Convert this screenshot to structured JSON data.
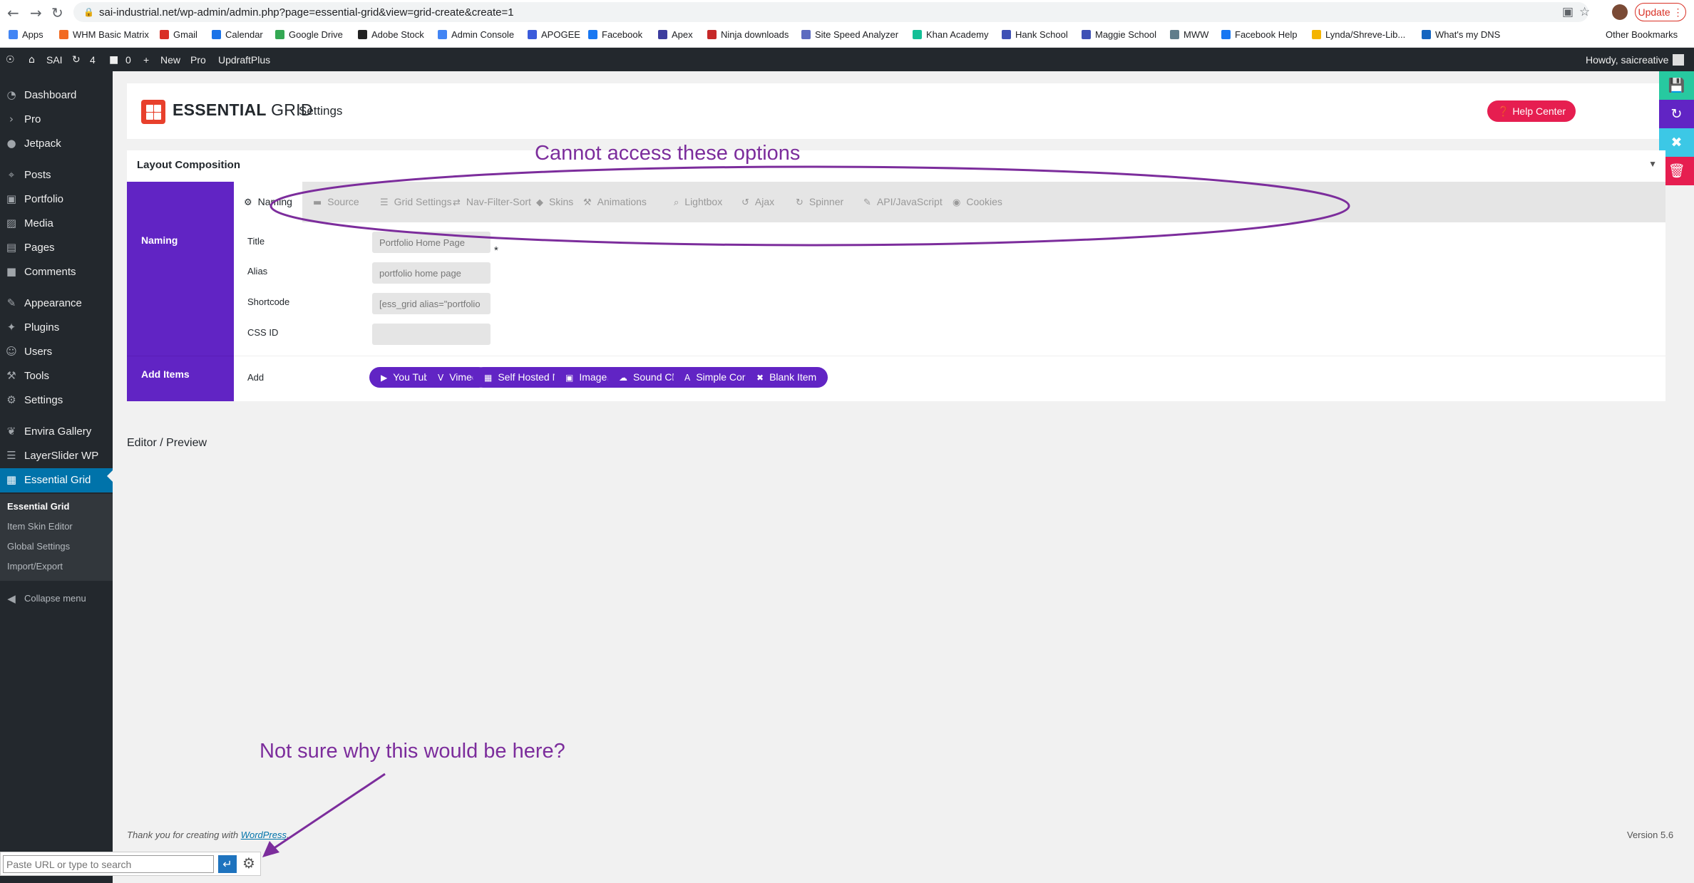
{
  "browser": {
    "url": "sai-industrial.net/wp-admin/admin.php?page=essential-grid&view=grid-create&create=1",
    "update_label": "Update",
    "bookmarks": [
      {
        "label": "Apps",
        "color": "#4285f4"
      },
      {
        "label": "WHM Basic Matrix",
        "color": "#f26a21"
      },
      {
        "label": "Gmail",
        "color": "#d93025"
      },
      {
        "label": "Calendar",
        "color": "#1a73e8"
      },
      {
        "label": "Google Drive",
        "color": "#34a853"
      },
      {
        "label": "Adobe Stock",
        "color": "#222222"
      },
      {
        "label": "Admin Console",
        "color": "#4285f4"
      },
      {
        "label": "APOGEE",
        "color": "#3b5bdb"
      },
      {
        "label": "Facebook",
        "color": "#1877f2"
      },
      {
        "label": "Apex",
        "color": "#3d3d9e"
      },
      {
        "label": "Ninja downloads",
        "color": "#c62828"
      },
      {
        "label": "Site Speed Analyzer",
        "color": "#5c6bc0"
      },
      {
        "label": "Khan Academy",
        "color": "#14bf96"
      },
      {
        "label": "Hank School",
        "color": "#3f51b5"
      },
      {
        "label": "Maggie School",
        "color": "#3f51b5"
      },
      {
        "label": "MWW",
        "color": "#607d8b"
      },
      {
        "label": "Facebook Help",
        "color": "#1877f2"
      },
      {
        "label": "Lynda/Shreve-Lib...",
        "color": "#f4b400"
      },
      {
        "label": "What's my DNS",
        "color": "#1565c0"
      }
    ],
    "other_bookmarks": "Other Bookmarks"
  },
  "adminbar": {
    "site": "SAI",
    "updates": "4",
    "comments": "0",
    "new": "New",
    "pro": "Pro",
    "updraft": "UpdraftPlus",
    "howdy": "Howdy, saicreative"
  },
  "sidebar": {
    "items": [
      {
        "label": "Dashboard",
        "icon": "dashboard-icon"
      },
      {
        "label": "Pro",
        "icon": "chevron-right-icon"
      },
      {
        "label": "Jetpack",
        "icon": "jetpack-icon"
      },
      {
        "label": "Posts",
        "icon": "pin-icon"
      },
      {
        "label": "Portfolio",
        "icon": "portfolio-icon"
      },
      {
        "label": "Media",
        "icon": "media-icon"
      },
      {
        "label": "Pages",
        "icon": "pages-icon"
      },
      {
        "label": "Comments",
        "icon": "comment-icon"
      },
      {
        "label": "Appearance",
        "icon": "brush-icon"
      },
      {
        "label": "Plugins",
        "icon": "plugin-icon"
      },
      {
        "label": "Users",
        "icon": "users-icon"
      },
      {
        "label": "Tools",
        "icon": "wrench-icon"
      },
      {
        "label": "Settings",
        "icon": "settings-icon"
      },
      {
        "label": "Envira Gallery",
        "icon": "leaf-icon"
      },
      {
        "label": "LayerSlider WP",
        "icon": "layers-icon"
      },
      {
        "label": "Essential Grid",
        "icon": "grid-icon"
      }
    ],
    "submenu": [
      "Essential Grid",
      "Item Skin Editor",
      "Global Settings",
      "Import/Export"
    ],
    "collapse": "Collapse menu"
  },
  "header": {
    "brand_bold": "ESSENTIAL",
    "brand_light": "GRID",
    "settings": "Settings",
    "help": "Help Center"
  },
  "layout": {
    "title": "Layout Composition",
    "sections": {
      "naming": "Naming",
      "add_items": "Add Items"
    },
    "tabs": [
      {
        "label": "Naming",
        "icon": "gear-icon"
      },
      {
        "label": "Source",
        "icon": "folder-icon"
      },
      {
        "label": "Grid Settings",
        "icon": "list-icon"
      },
      {
        "label": "Nav-Filter-Sort",
        "icon": "shuffle-icon"
      },
      {
        "label": "Skins",
        "icon": "drop-icon"
      },
      {
        "label": "Animations",
        "icon": "tools-icon"
      },
      {
        "label": "Lightbox",
        "icon": "search-icon"
      },
      {
        "label": "Ajax",
        "icon": "undo-icon"
      },
      {
        "label": "Spinner",
        "icon": "history-icon"
      },
      {
        "label": "API/JavaScript",
        "icon": "pencil-icon"
      },
      {
        "label": "Cookies",
        "icon": "eye-icon"
      }
    ],
    "fields": {
      "title_label": "Title",
      "title_value": "Portfolio Home Page",
      "alias_label": "Alias",
      "alias_value": "portfolio home page",
      "alias_required": "*",
      "shortcode_label": "Shortcode",
      "shortcode_value": "[ess_grid alias=\"portfolio home page\"]",
      "cssid_label": "CSS ID",
      "cssid_value": ""
    },
    "add_label": "Add",
    "add_buttons": [
      {
        "label": "You Tube",
        "icon": "youtube-icon"
      },
      {
        "label": "Vimeo",
        "icon": "vimeo-icon"
      },
      {
        "label": "Self Hosted Media",
        "icon": "film-icon"
      },
      {
        "label": "Image(s)",
        "icon": "image-icon"
      },
      {
        "label": "Sound Cloud",
        "icon": "soundcloud-icon"
      },
      {
        "label": "Simple Content",
        "icon": "text-icon"
      },
      {
        "label": "Blank Item",
        "icon": "close-icon"
      }
    ]
  },
  "editor_preview": "Editor / Preview",
  "footer": {
    "thanks": "Thank you for creating with",
    "wp_link": "WordPress",
    "version": "Version 5.6"
  },
  "search_widget": {
    "placeholder": "Paste URL or type to search"
  },
  "annotations": {
    "top": "Cannot access these options",
    "bottom": "Not sure why this would be here?",
    "color": "#7c2d9c"
  }
}
